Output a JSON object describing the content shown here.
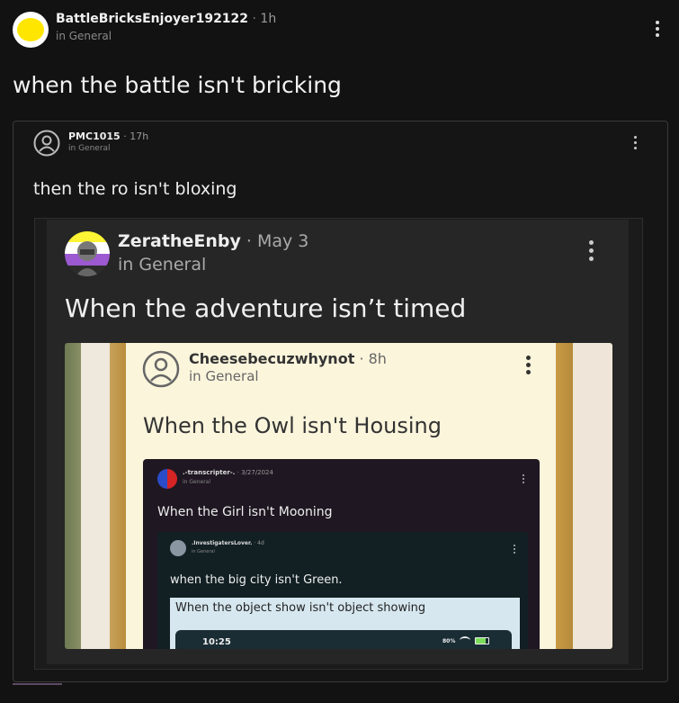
{
  "post": {
    "username": "BattleBricksEnjoyer192122",
    "time": "1h",
    "forum": "in General",
    "title": "when the battle isn't bricking",
    "avatar_color": "#ffe600"
  },
  "quote1": {
    "username": "PMC1015",
    "time": "17h",
    "forum": "in General",
    "title": "then the ro isn't bloxing"
  },
  "quote2": {
    "username": "ZeratheEnby",
    "time": "May 3",
    "forum": "in General",
    "title": "When the adventure isn’t timed"
  },
  "quote3": {
    "username": "Cheesebecuzwhynot",
    "time": "8h",
    "forum": "in General",
    "title": "When the Owl isn't Housing"
  },
  "quote4": {
    "username": ".-transcripter-.",
    "time": "3/27/2024",
    "forum": "in General",
    "title": "When the Girl isn't Mooning"
  },
  "quote5": {
    "username": ".InvestigatersLover.",
    "time": "4d",
    "forum": "in General",
    "title": "when the big city isn't Green."
  },
  "quote6": {
    "title": "When the object show isn't object showing",
    "clock": "10:25",
    "battery": "80%"
  },
  "separator": "·",
  "colors": {
    "background": "#121212",
    "cream_card": "#fbf5dc",
    "dark_card": "#1f1722"
  }
}
